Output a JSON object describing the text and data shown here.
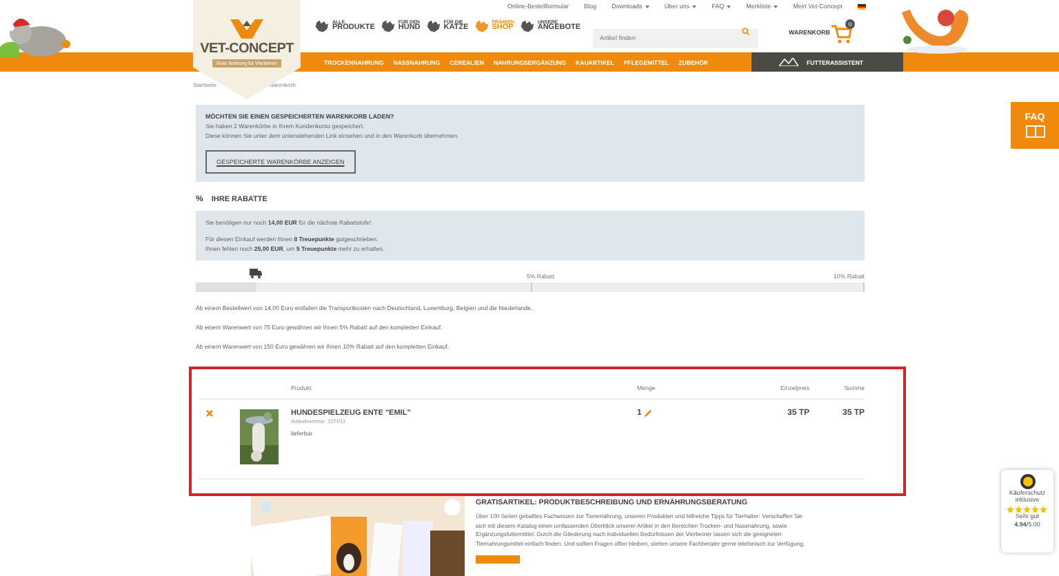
{
  "top_links": [
    {
      "label": "Online-Bestellformular",
      "dropdown": false
    },
    {
      "label": "Blog",
      "dropdown": false
    },
    {
      "label": "Downloads",
      "dropdown": true
    },
    {
      "label": "Über uns",
      "dropdown": true
    },
    {
      "label": "FAQ",
      "dropdown": true
    },
    {
      "label": "Merkliste",
      "dropdown": true
    },
    {
      "label": "Mein Vet-Concept",
      "dropdown": false
    }
  ],
  "logo": {
    "name": "VET-CONCEPT",
    "tagline": "Gute Nahrung für Vierbeiner"
  },
  "categories": [
    {
      "small": "ALLE",
      "big": "PRODUKTE",
      "highlighted": false
    },
    {
      "small": "FÜR DEN",
      "big": "HUND",
      "highlighted": false
    },
    {
      "small": "FÜR DIE",
      "big": "KATZE",
      "highlighted": false
    },
    {
      "small": "PRÄMIEN",
      "big": "SHOP",
      "highlighted": true
    },
    {
      "small": "UNSERE",
      "big": "ANGEBOTE",
      "highlighted": false
    }
  ],
  "search": {
    "placeholder": "Artikel finden"
  },
  "cart": {
    "label": "WARENKORB",
    "count": "0"
  },
  "nav": {
    "items": [
      "TROCKENNAHRUNG",
      "NASSNAHRUNG",
      "CEREALIEN",
      "NAHRUNGSERGÄNZUNG",
      "KAUARTIKEL",
      "PFLEGEMITTEL",
      "ZUBEHÖR"
    ],
    "assistant": "FUTTERASSISTENT"
  },
  "breadcrumb": [
    "Startseite",
    "Warenkorb"
  ],
  "saved_carts": {
    "title": "MÖCHTEN SIE EINEN GESPEICHERTEN WARENKORB LADEN?",
    "lines": [
      "Sie haben 2 Warenkörbe in Ihrem Kundenkonto gespeichert.",
      "Diese können Sie unter dem untenstehenden Link einsehen und in den Warenkorb übernehmen."
    ],
    "button": "GESPEICHERTE WARENKÖRBE ANZEIGEN"
  },
  "discounts": {
    "symbol": "%",
    "heading": "IHRE RABATTE",
    "info": [
      "Sie benötigen nur noch **14,00 EUR** für die nächste Rabattstufe!",
      "Für diesen Einkauf werden Ihnen **8 Treuepunkte** gutgeschrieben.",
      "Ihnen fehlen noch **25,00 EUR**, um **5 Treuepunkte** mehr zu erhalten."
    ],
    "progress": {
      "level": 0.09,
      "labels": [
        "5% Rabatt",
        "10% Rabatt"
      ]
    },
    "notes": [
      "Ab einem Bestellwert von 14,00 Euro entfallen die Transportkosten nach Deutschland, Luxemburg, Belgien und die Niederlande.",
      "Ab einem Warenwert von 75 Euro gewähren wir Ihnen 5% Rabatt auf den kompletten Einkauf.",
      "Ab einem Warenwert von 150 Euro gewähren wir Ihnen 10% Rabatt auf den kompletten Einkauf."
    ]
  },
  "cart_table": {
    "columns": [
      "Produkt",
      "Menge",
      "Einzelpreis",
      "Summe"
    ],
    "rows": [
      {
        "name": "HUNDESPIELZEUG ENTE \"EMIL\"",
        "article_number": "Artikelnummer: 22TP11",
        "availability": "lieferbar",
        "quantity": "1",
        "unit_price": "35 TP",
        "total": "35 TP"
      }
    ]
  },
  "free_item": {
    "title": "GRATISARTIKEL: PRODUKTBESCHREIBUNG UND ERNÄHRUNGSBERATUNG",
    "text": "Über 100 Seiten geballtes Fachwissen zur Tierernährung, unseren Produkten und hilfreiche Tipps für Tierhalter: Verschaffen Sie sich mit diesem Katalog einen umfassenden Überblick unserer Artikel in den Bereichen Trocken- und Nassnahrung, sowie Ergänzungsfuttermittel. Durch die Gliederung nach individuellen Bedürfnissen der Vierbeiner lassen sich die geeigneten Tiernahrungsmittel einfach finden. Und sollten Fragen offen bleiben, stehen unsere Fachberater gerne telefonisch zur Verfügung."
  },
  "faq_tab": {
    "label": "FAQ"
  },
  "trust_badge": {
    "title": "Käuferschutz inklusive",
    "stars": 5,
    "rating": "Sehr gut",
    "score": "**4.94**/5.00"
  }
}
